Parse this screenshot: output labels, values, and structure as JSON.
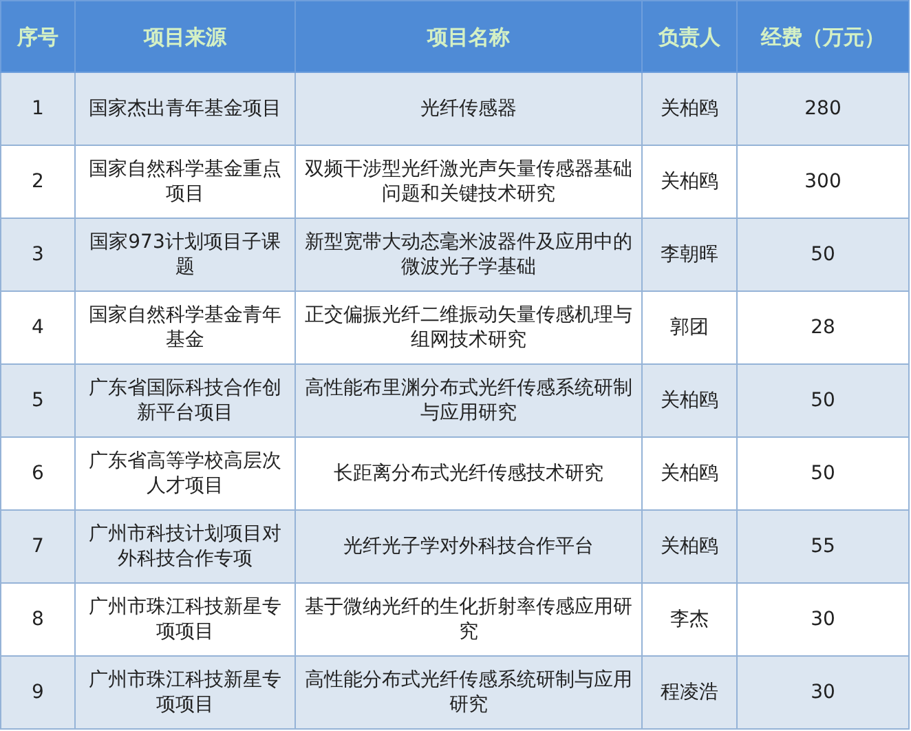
{
  "table": {
    "columns": [
      "序号",
      "项目来源",
      "项目名称",
      "负责人",
      "经费（万元）"
    ],
    "rows": [
      {
        "number": "1",
        "source": "国家杰出青年基金项目",
        "name": "光纤传感器",
        "leader": "关柏鸥",
        "funding": "280"
      },
      {
        "number": "2",
        "source": "国家自然科学基金重点项目",
        "name": "双频干涉型光纤激光声矢量传感器基础问题和关键技术研究",
        "leader": "关柏鸥",
        "funding": "300"
      },
      {
        "number": "3",
        "source": "国家973计划项目子课题",
        "name": "新型宽带大动态毫米波器件及应用中的微波光子学基础",
        "leader": "李朝晖",
        "funding": "50"
      },
      {
        "number": "4",
        "source": "国家自然科学基金青年基金",
        "name": "正交偏振光纤二维振动矢量传感机理与组网技术研究",
        "leader": "郭团",
        "funding": "28"
      },
      {
        "number": "5",
        "source": "广东省国际科技合作创新平台项目",
        "name": "高性能布里渊分布式光纤传感系统研制与应用研究",
        "leader": "关柏鸥",
        "funding": "50"
      },
      {
        "number": "6",
        "source": "广东省高等学校高层次人才项目",
        "name": "长距离分布式光纤传感技术研究",
        "leader": "关柏鸥",
        "funding": "50"
      },
      {
        "number": "7",
        "source": "广州市科技计划项目对外科技合作专项",
        "name": "光纤光子学对外科技合作平台",
        "leader": "关柏鸥",
        "funding": "55"
      },
      {
        "number": "8",
        "source": "广州市珠江科技新星专项项目",
        "name": "基于微纳光纤的生化折射率传感应用研究",
        "leader": "李杰",
        "funding": "30"
      },
      {
        "number": "9",
        "source": "广州市珠江科技新星专项项目",
        "name": "高性能分布式光纤传感系统研制与应用研究",
        "leader": "程凌浩",
        "funding": "30"
      }
    ]
  }
}
